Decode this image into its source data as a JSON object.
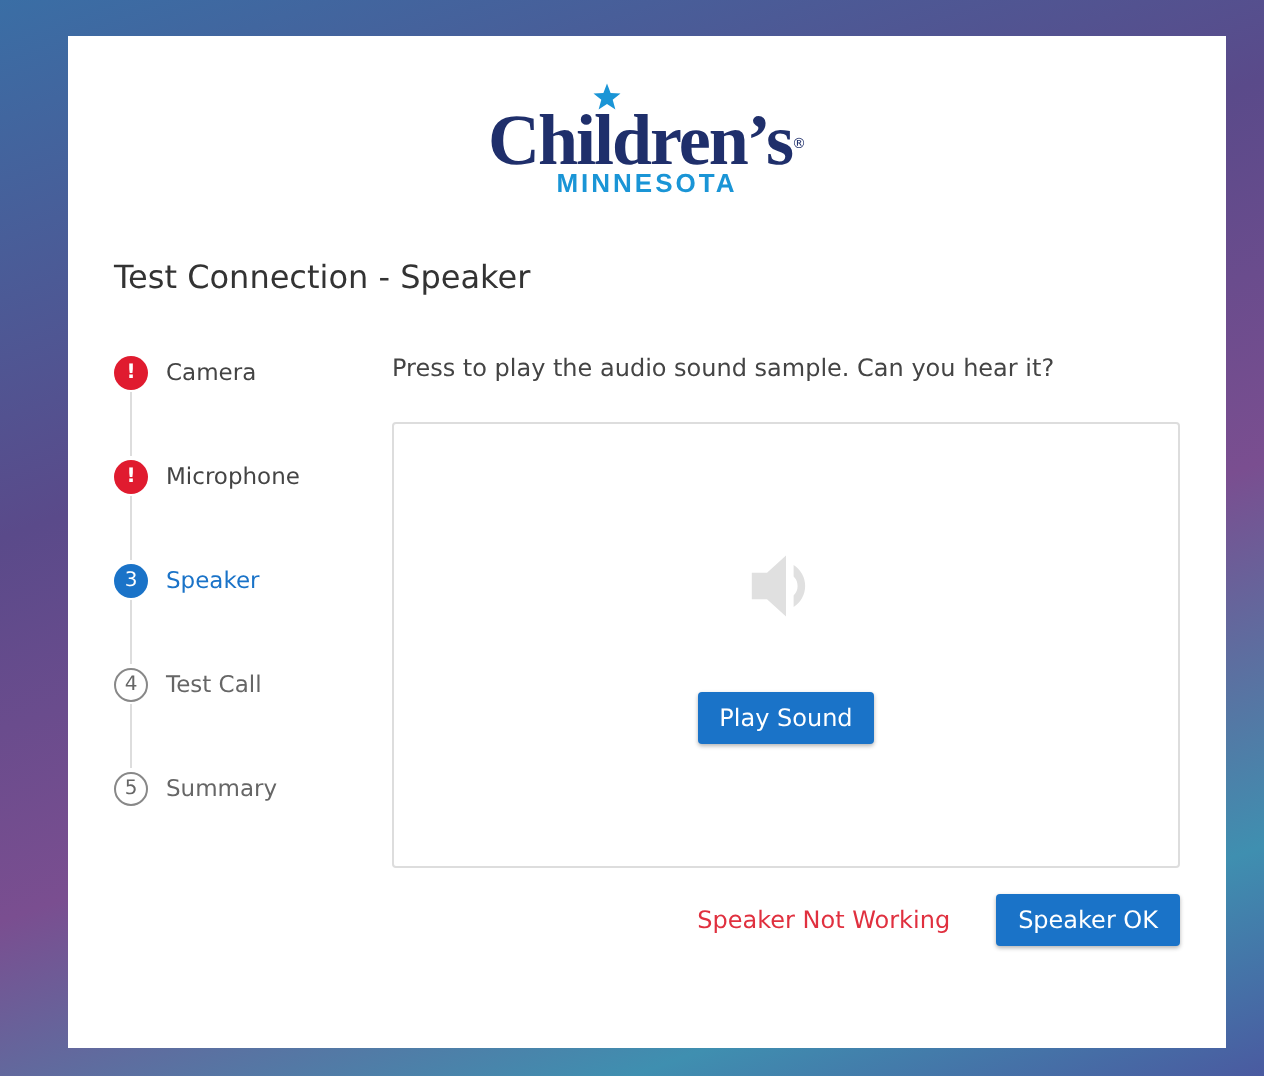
{
  "logo": {
    "name": "Children’s",
    "registered": "®",
    "subtitle": "MINNESOTA"
  },
  "title": "Test Connection - Speaker",
  "steps": [
    {
      "label": "Camera",
      "marker": "!",
      "kind": "error"
    },
    {
      "label": "Microphone",
      "marker": "!",
      "kind": "error"
    },
    {
      "label": "Speaker",
      "marker": "3",
      "kind": "active"
    },
    {
      "label": "Test Call",
      "marker": "4",
      "kind": "pending"
    },
    {
      "label": "Summary",
      "marker": "5",
      "kind": "pending"
    }
  ],
  "prompt": "Press to play the audio sound sample. Can you hear it?",
  "play_button": "Play Sound",
  "actions": {
    "not_working": "Speaker Not Working",
    "ok": "Speaker OK"
  }
}
